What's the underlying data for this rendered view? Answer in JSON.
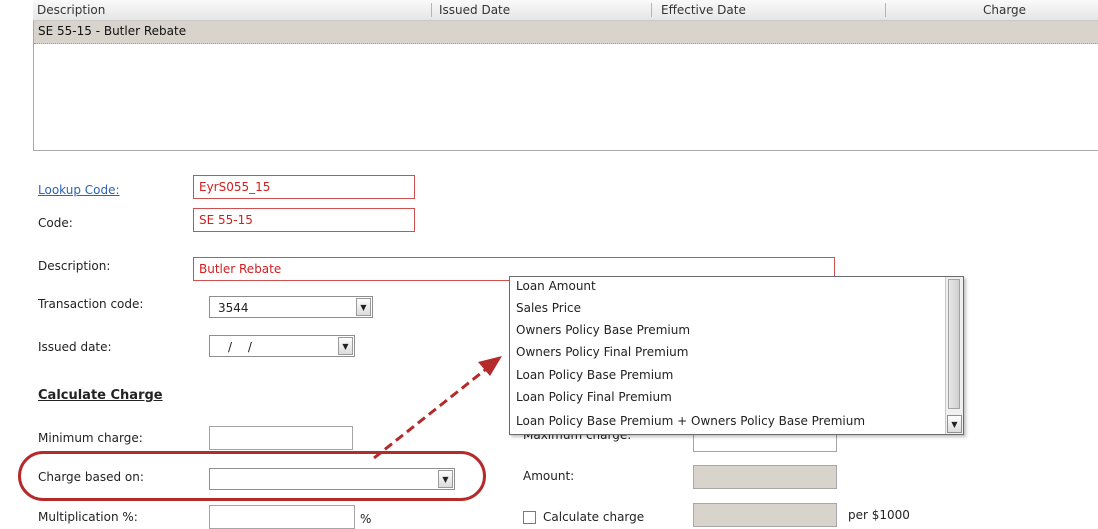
{
  "table": {
    "columns": [
      "Description",
      "Issued Date",
      "Effective Date",
      "Charge"
    ],
    "rows": [
      {
        "description": "SE 55-15 - Butler Rebate",
        "issued": "",
        "effective": "",
        "charge": ""
      }
    ]
  },
  "form": {
    "lookup_code_label": "Lookup Code:",
    "lookup_code_value": "EyrS055_15",
    "code_label": "Code:",
    "code_value": "SE 55-15",
    "description_label": "Description:",
    "description_value": "Butler Rebate",
    "transaction_code_label": "Transaction code:",
    "transaction_code_value": "3544",
    "issued_date_label": "Issued date:",
    "issued_date_value": "/ /",
    "calculate_charge_title": "Calculate Charge",
    "minimum_charge_label": "Minimum charge:",
    "minimum_charge_value": "",
    "charge_based_on_label": "Charge based on:",
    "charge_based_on_value": "",
    "multiplication_label": "Multiplication %:",
    "multiplication_value": "",
    "percent_symbol": "%",
    "maximum_charge_label": "Maximum charge:",
    "amount_label": "Amount:",
    "calculate_charge_checkbox_label": "Calculate charge",
    "calculate_charge_checked": false,
    "per_label": "per $1000"
  },
  "dropdown": {
    "options": [
      "Loan Amount",
      "Sales Price",
      "Owners Policy Base Premium",
      "Owners Policy Final Premium",
      "Loan Policy Base Premium",
      "Loan Policy Final Premium",
      "Loan Policy Base Premium + Owners Policy Base Premium"
    ]
  },
  "icons": {
    "combo_arrow": "chevron-down-icon",
    "annotation_arrow": "dashed-arrow-icon"
  },
  "colors": {
    "required_text": "#d21f1f",
    "link": "#2a63b8",
    "annotation": "#b52b2b",
    "selected_row": "#d8d4cc"
  }
}
